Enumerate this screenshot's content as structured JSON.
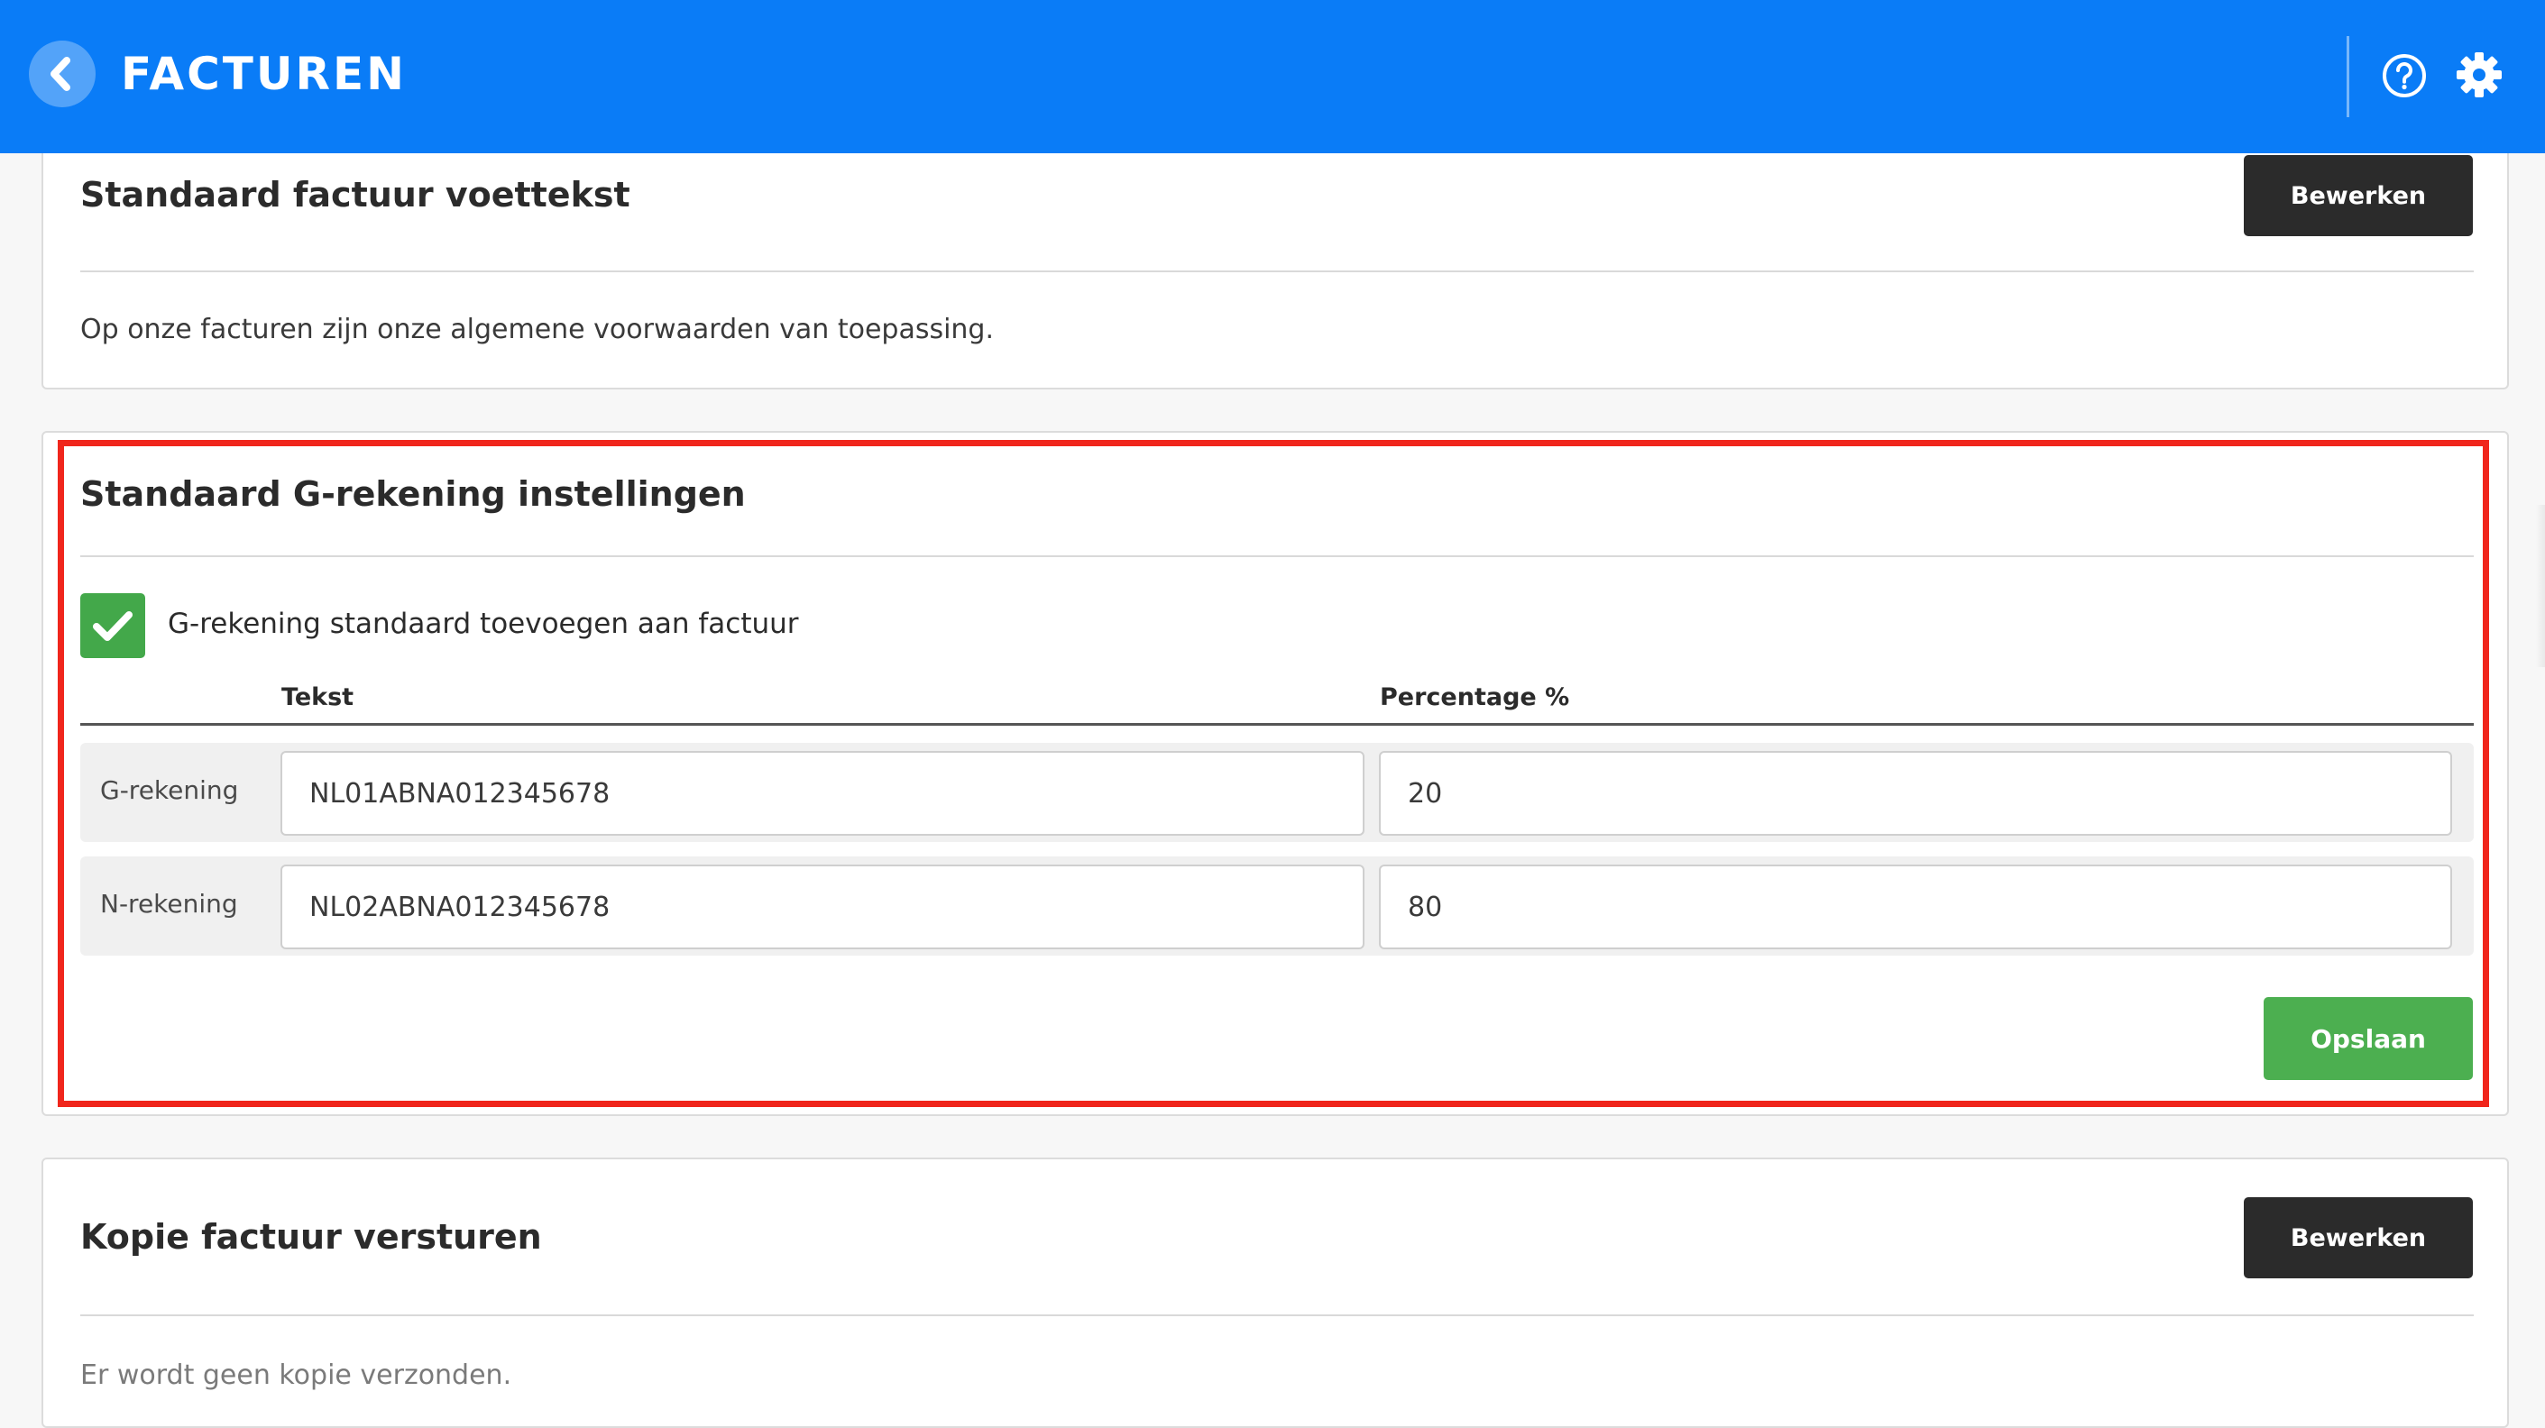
{
  "header": {
    "title": "FACTUREN",
    "back_icon": "chevron-left-icon",
    "help_icon": "help-circle-icon",
    "settings_icon": "gear-icon",
    "background_color": "#0a7cf7"
  },
  "footer_card": {
    "title": "Standaard factuur voettekst",
    "edit_label": "Bewerken",
    "text": "Op onze facturen zijn onze algemene voorwaarden van toepassing."
  },
  "g_account_card": {
    "title": "Standaard G-rekening instellingen",
    "checkbox_label": "G-rekening standaard toevoegen aan factuur",
    "checkbox_checked": true,
    "columns": [
      "Tekst",
      "Percentage %"
    ],
    "rows": [
      {
        "label": "G-rekening",
        "text": "NL01ABNA012345678",
        "percentage": "20"
      },
      {
        "label": "N-rekening",
        "text": "NL02ABNA012345678",
        "percentage": "80"
      }
    ],
    "save_label": "Opslaan",
    "highlight_color": "#f0261c"
  },
  "copy_card": {
    "title": "Kopie factuur versturen",
    "edit_label": "Bewerken",
    "text": "Er wordt geen kopie verzonden."
  },
  "colors": {
    "dark_button": "#2b2b2b",
    "save_button": "#4caf50",
    "checkbox": "#43a84a"
  }
}
